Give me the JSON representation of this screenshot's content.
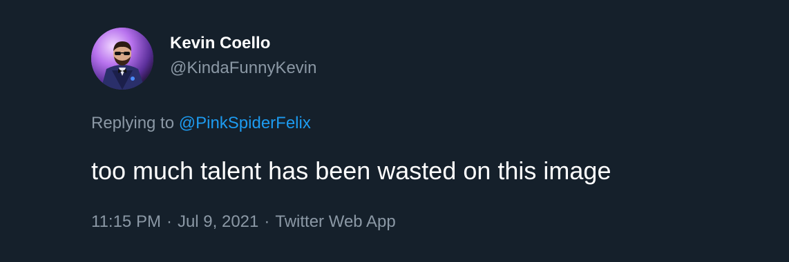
{
  "author": {
    "display_name": "Kevin Coello",
    "handle": "@KindaFunnyKevin"
  },
  "reply": {
    "prefix": "Replying to",
    "target": "@PinkSpiderFelix"
  },
  "tweet": {
    "text": "too much talent has been wasted on this image"
  },
  "meta": {
    "time": "11:15 PM",
    "separator": "·",
    "date": "Jul 9, 2021",
    "source": "Twitter Web App"
  },
  "colors": {
    "background": "#15202b",
    "primary_text": "#ffffff",
    "secondary_text": "#8b98a5",
    "link": "#1d9bf0"
  }
}
